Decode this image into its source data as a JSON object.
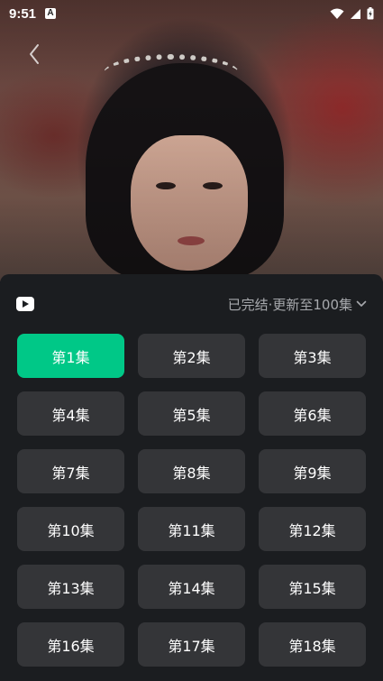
{
  "status_bar": {
    "time": "9:51",
    "notification_icon": "a-icon"
  },
  "player": {
    "back_icon": "chevron-left-icon"
  },
  "episode_sheet": {
    "badge_icon": "play-badge-icon",
    "status_text": "已完结·更新至100集",
    "expand_icon": "chevron-down-icon",
    "active_color": "#00c887",
    "episodes": [
      {
        "label": "第1集",
        "active": true
      },
      {
        "label": "第2集",
        "active": false
      },
      {
        "label": "第3集",
        "active": false
      },
      {
        "label": "第4集",
        "active": false
      },
      {
        "label": "第5集",
        "active": false
      },
      {
        "label": "第6集",
        "active": false
      },
      {
        "label": "第7集",
        "active": false
      },
      {
        "label": "第8集",
        "active": false
      },
      {
        "label": "第9集",
        "active": false
      },
      {
        "label": "第10集",
        "active": false
      },
      {
        "label": "第11集",
        "active": false
      },
      {
        "label": "第12集",
        "active": false
      },
      {
        "label": "第13集",
        "active": false
      },
      {
        "label": "第14集",
        "active": false
      },
      {
        "label": "第15集",
        "active": false
      },
      {
        "label": "第16集",
        "active": false
      },
      {
        "label": "第17集",
        "active": false
      },
      {
        "label": "第18集",
        "active": false
      }
    ]
  }
}
